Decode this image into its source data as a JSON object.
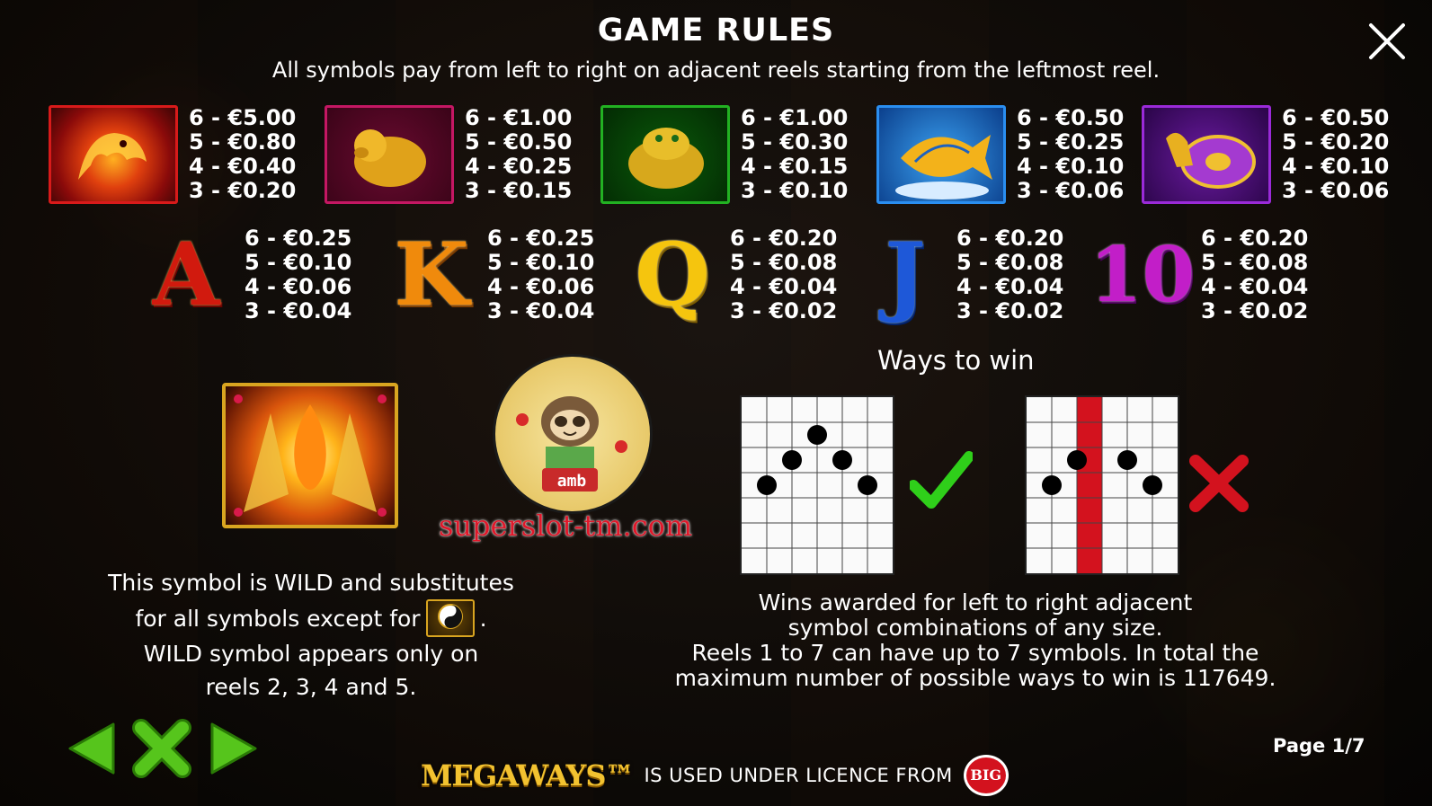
{
  "title": "GAME RULES",
  "subtitle": "All symbols pay from left to right on adjacent reels starting from the leftmost reel.",
  "high_symbols": [
    {
      "name": "dragon",
      "color": "#d81a1a",
      "pays": [
        "6 - €5.00",
        "5 - €0.80",
        "4 - €0.40",
        "3 - €0.20"
      ]
    },
    {
      "name": "pig",
      "color": "#b81457",
      "pays": [
        "6 - €1.00",
        "5 - €0.50",
        "4 - €0.25",
        "3 - €0.15"
      ]
    },
    {
      "name": "toad",
      "color": "#1aa11a",
      "pays": [
        "6 - €1.00",
        "5 - €0.30",
        "4 - €0.15",
        "3 - €0.10"
      ]
    },
    {
      "name": "koi",
      "color": "#1c6fd6",
      "pays": [
        "6 - €0.50",
        "5 - €0.25",
        "4 - €0.10",
        "3 - €0.06"
      ]
    },
    {
      "name": "turtle",
      "color": "#8a22c8",
      "pays": [
        "6 - €0.50",
        "5 - €0.20",
        "4 - €0.10",
        "3 - €0.06"
      ]
    }
  ],
  "low_symbols": [
    {
      "glyph": "A",
      "color": "#d11a0e",
      "pays": [
        "6 - €0.25",
        "5 - €0.10",
        "4 - €0.06",
        "3 - €0.04"
      ]
    },
    {
      "glyph": "K",
      "color": "#f08a0c",
      "pays": [
        "6 - €0.25",
        "5 - €0.10",
        "4 - €0.06",
        "3 - €0.04"
      ]
    },
    {
      "glyph": "Q",
      "color": "#f5c50e",
      "pays": [
        "6 - €0.20",
        "5 - €0.08",
        "4 - €0.04",
        "3 - €0.02"
      ]
    },
    {
      "glyph": "J",
      "color": "#1e58d8",
      "pays": [
        "6 - €0.20",
        "5 - €0.08",
        "4 - €0.04",
        "3 - €0.02"
      ]
    },
    {
      "glyph": "10",
      "color": "#c21ec8",
      "pays": [
        "6 - €0.20",
        "5 - €0.08",
        "4 - €0.04",
        "3 - €0.02"
      ]
    }
  ],
  "wild": {
    "line1": "This symbol is WILD and substitutes",
    "line2a": "for all symbols except for",
    "line2b": ".",
    "line3": "WILD symbol appears only on",
    "line4": "reels 2, 3, 4 and 5."
  },
  "watermark": "superslot-tm.com",
  "watermark_logo_text": "amb",
  "ways": {
    "title": "Ways to win",
    "grid_cols": 6,
    "grid_rows": 7,
    "valid_dots": [
      [
        0,
        3
      ],
      [
        1,
        2
      ],
      [
        2,
        1
      ],
      [
        3,
        2
      ],
      [
        4,
        3
      ]
    ],
    "invalid_dots": [
      [
        0,
        3
      ],
      [
        1,
        2
      ],
      [
        3,
        2
      ],
      [
        4,
        3
      ]
    ],
    "invalid_blocked_col": 2,
    "desc1": "Wins awarded for left to right adjacent",
    "desc2": "symbol combinations of any size.",
    "desc3": "Reels 1 to 7 can have up to 7 symbols. In total the",
    "desc4": "maximum number of possible ways to win is 117649."
  },
  "nav": {
    "page": "Page 1/7"
  },
  "licence": {
    "brand": "MEGAWAYS™",
    "text": "IS USED UNDER LICENCE FROM",
    "badge": "BIG"
  },
  "colors": {
    "nav_green": "#56c51c",
    "check_green": "#2fcf1a",
    "cross_red": "#d3121e",
    "reel_red": "#d3121e"
  }
}
